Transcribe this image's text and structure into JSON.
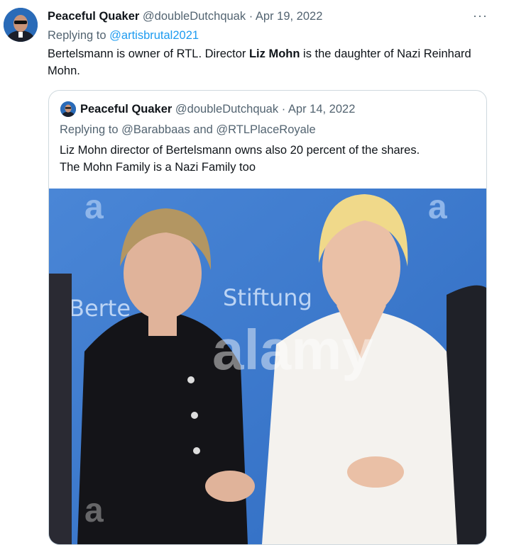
{
  "tweet": {
    "author_name": "Peaceful Quaker",
    "handle": "@doubleDutchquak",
    "separator": "·",
    "date": "Apr 19, 2022",
    "replying_prefix": "Replying to",
    "replying_to": "@artisbrutal2021",
    "text_part1": "Bertelsmann is owner of RTL. Director ",
    "text_bold": "Liz Mohn",
    "text_part2": " is the daughter of Nazi Reinhard Mohn.",
    "more_icon": "···"
  },
  "quote": {
    "author_name": "Peaceful Quaker",
    "handle": "@doubleDutchquak",
    "separator": "·",
    "date": "Apr 14, 2022",
    "replying_text": "Replying to @Barabbaas and @RTLPlaceRoyale",
    "text_line1": "Liz Mohn director of Bertelsmann owns also 20 percent of the shares.",
    "text_line2": "The Mohn Family is a Nazi Family too"
  },
  "photo": {
    "backdrop_words": [
      "Berte",
      "Stiftung"
    ],
    "watermark": "alamy",
    "logo_letter": "a"
  },
  "colors": {
    "link": "#1d9bf0",
    "muted": "#536471",
    "border": "#cfd9de",
    "backdrop": "#3f7fd0"
  }
}
